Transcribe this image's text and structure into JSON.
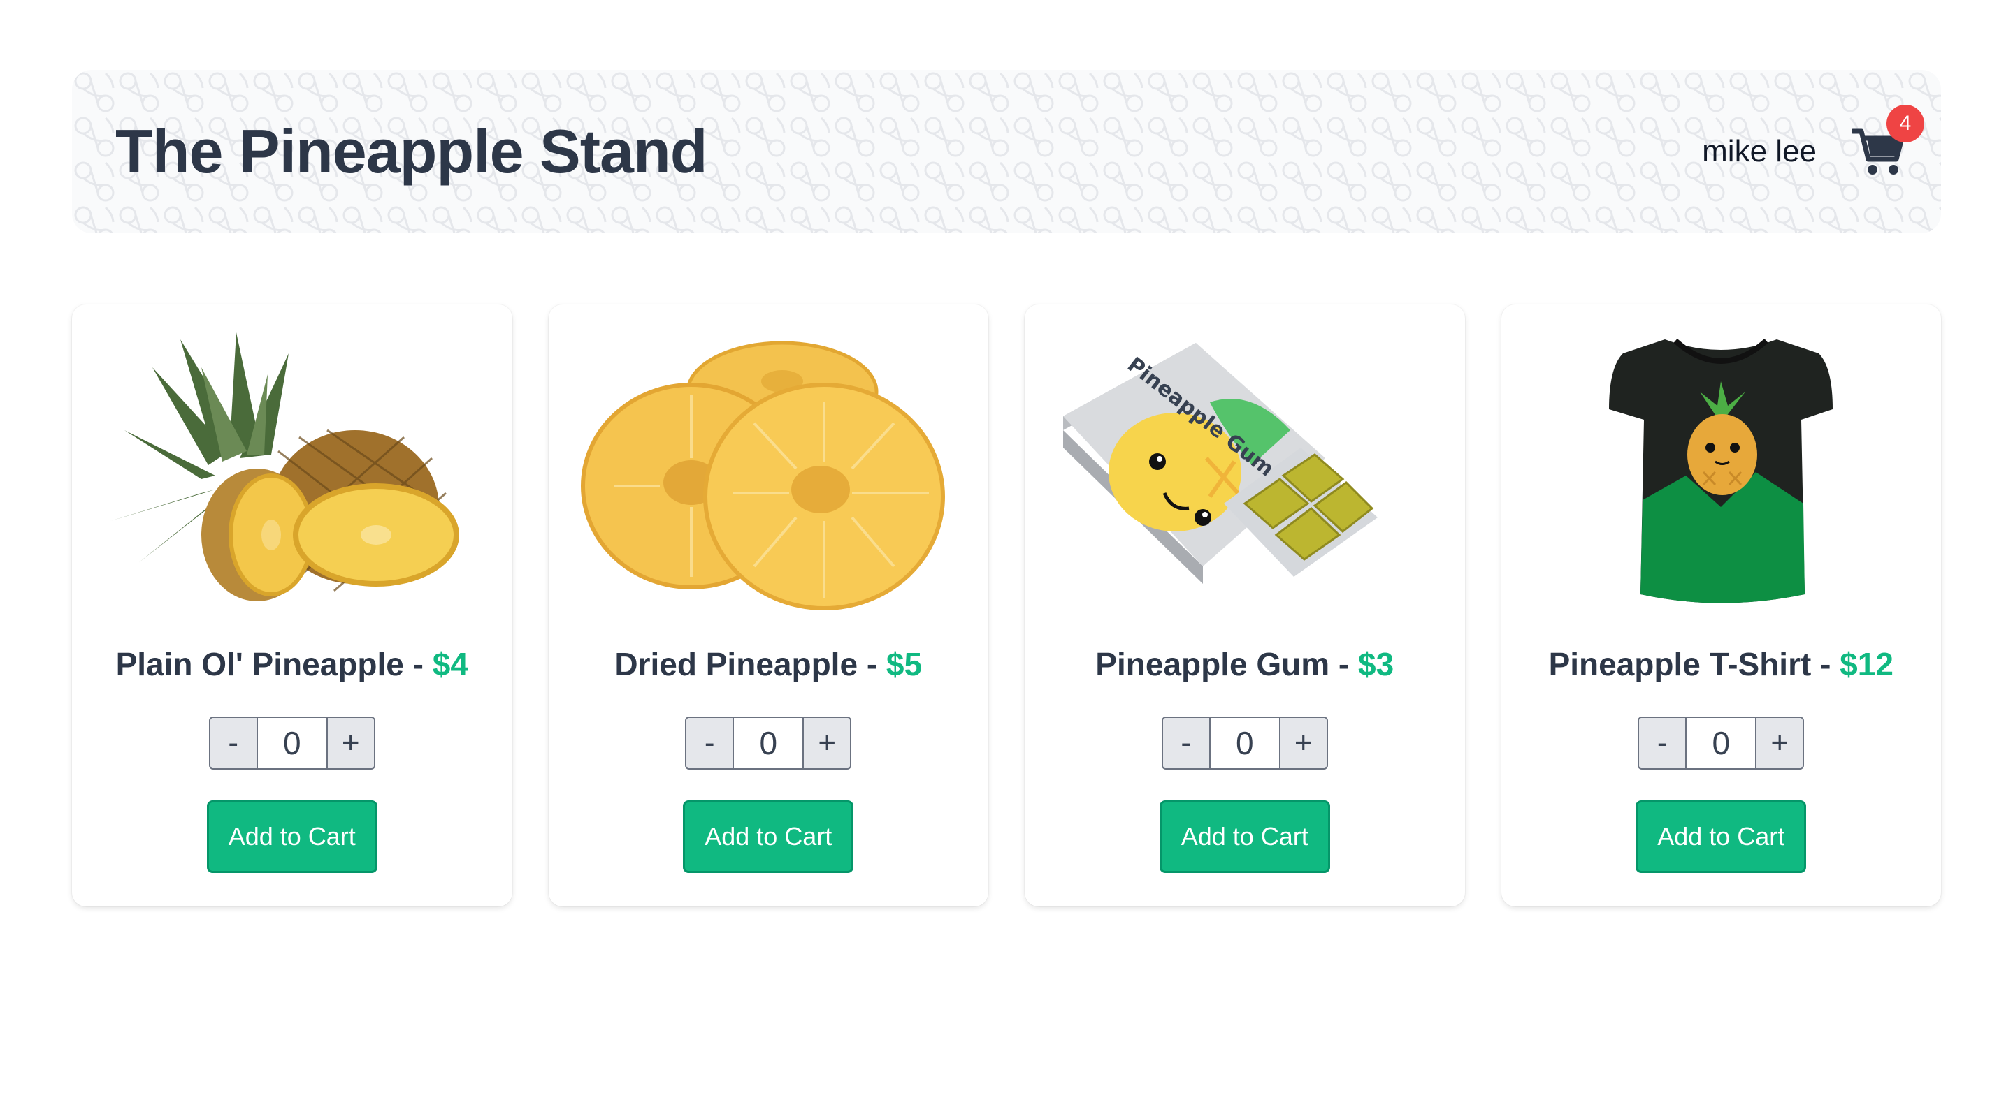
{
  "header": {
    "title": "The Pineapple Stand",
    "user_name": "mike lee",
    "cart_count": "4",
    "cart_icon": "shopping-cart-icon"
  },
  "products": [
    {
      "name": "Plain Ol' Pineapple - ",
      "price": "$4",
      "quantity": "0",
      "minus": "-",
      "plus": "+",
      "add_label": "Add to Cart",
      "image": "pineapple-image"
    },
    {
      "name": "Dried Pineapple - ",
      "price": "$5",
      "quantity": "0",
      "minus": "-",
      "plus": "+",
      "add_label": "Add to Cart",
      "image": "dried-pineapple-image"
    },
    {
      "name": "Pineapple Gum - ",
      "price": "$3",
      "quantity": "0",
      "minus": "-",
      "plus": "+",
      "add_label": "Add to Cart",
      "image": "pineapple-gum-image",
      "image_text": "Pineapple Gum"
    },
    {
      "name": "Pineapple T-Shirt - ",
      "price": "$12",
      "quantity": "0",
      "minus": "-",
      "plus": "+",
      "add_label": "Add to Cart",
      "image": "pineapple-tshirt-image"
    }
  ],
  "colors": {
    "accent": "#10b981",
    "badge": "#ef4444",
    "title": "#2d3748"
  }
}
